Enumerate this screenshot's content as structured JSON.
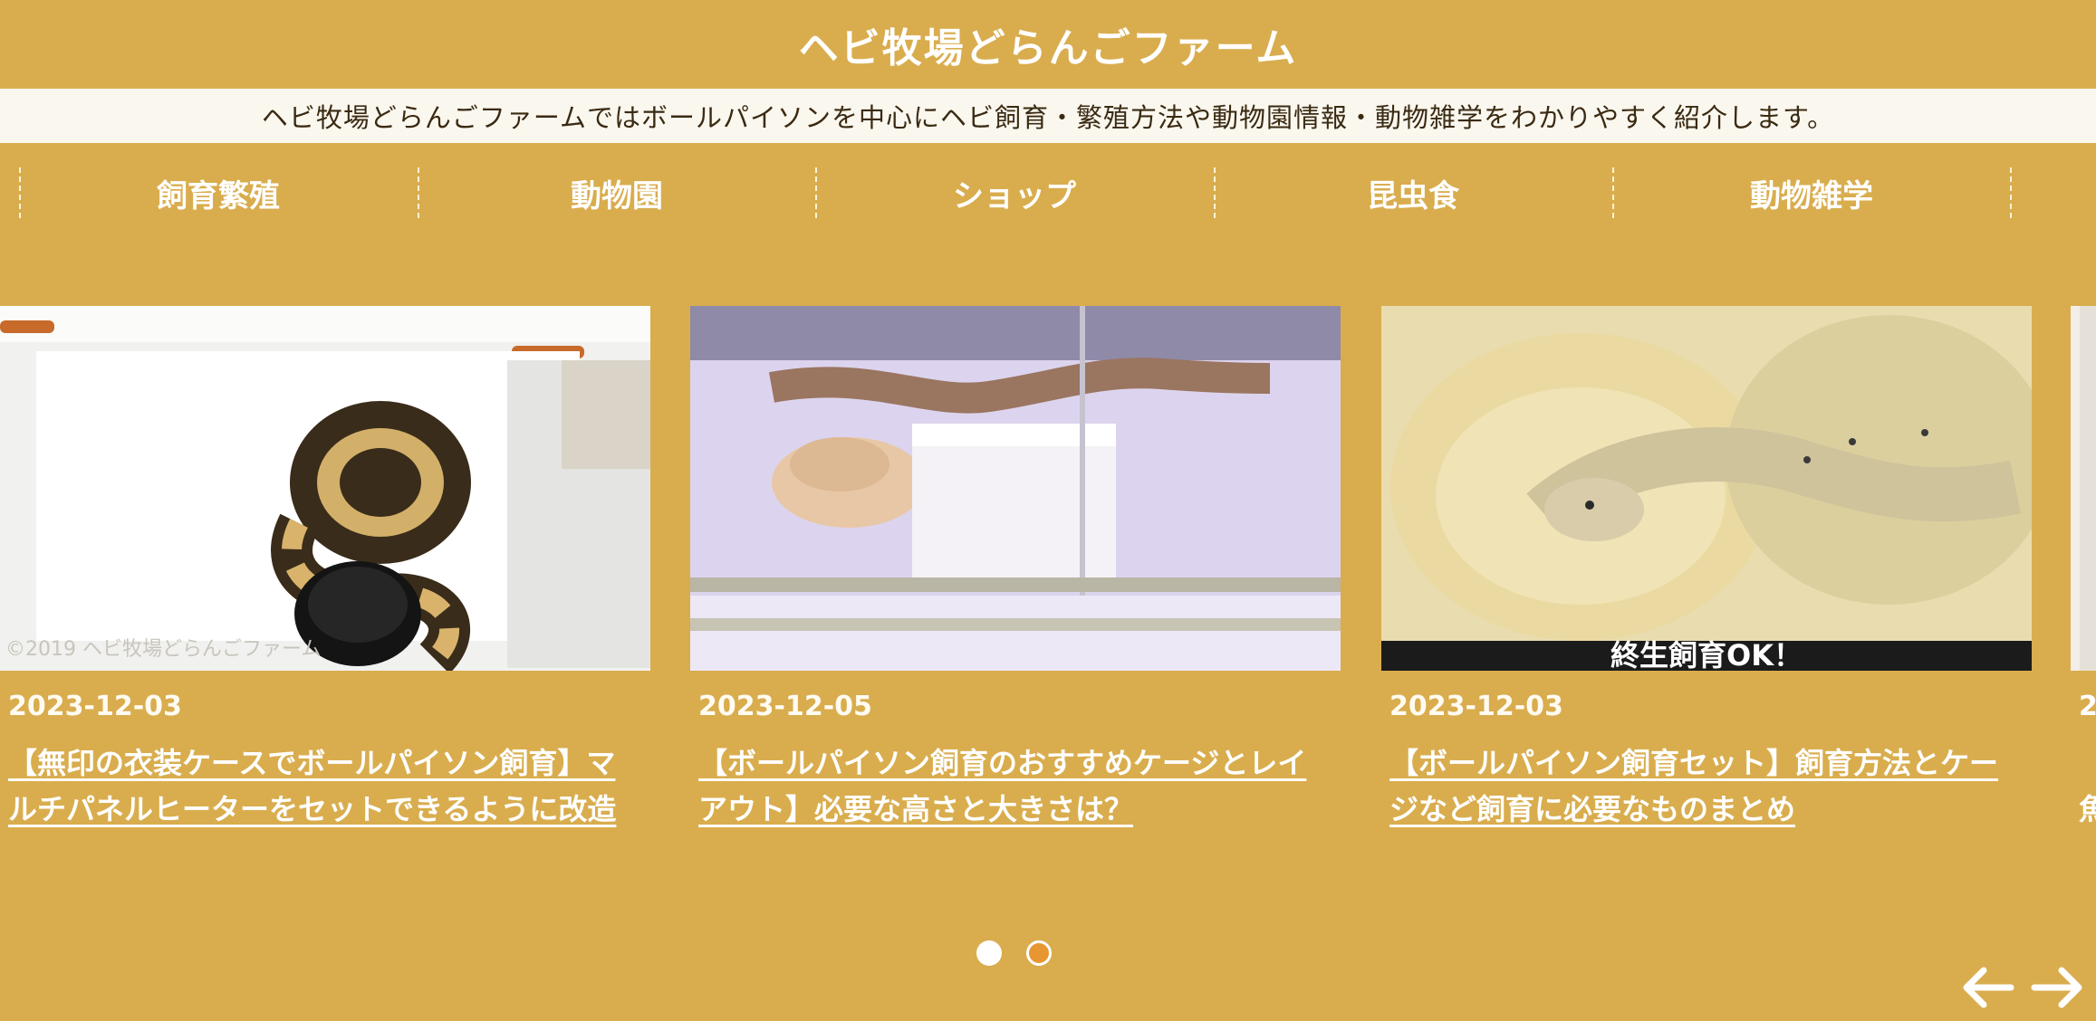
{
  "header": {
    "site_title": "ヘビ牧場どらんごファーム",
    "tagline": "ヘビ牧場どらんごファームではボールパイソンを中心にヘビ飼育・繁殖方法や動物園情報・動物雑学をわかりやすく紹介します。"
  },
  "nav": {
    "items": [
      {
        "label": "飼育繁殖"
      },
      {
        "label": "動物園"
      },
      {
        "label": "ショップ"
      },
      {
        "label": "昆虫食"
      },
      {
        "label": "動物雑学"
      }
    ]
  },
  "slider": {
    "cards": [
      {
        "date": "2023-12-03",
        "title": "【無印の衣装ケースでボールパイソン飼育】マルチパネルヒーターをセットできるように改造",
        "image_watermark": "©2019 ヘビ牧場どらんごファーム"
      },
      {
        "date": "2023-12-05",
        "title": "【ボールパイソン飼育のおすすめケージとレイアウト】必要な高さと大きさは？"
      },
      {
        "date": "2023-12-03",
        "title": "【ボールパイソン飼育セット】飼育方法とケージなど飼育に必要なものまとめ",
        "image_caption": "終生飼育OK！"
      }
    ],
    "peek_card": {
      "date": "2",
      "title_fragment": "【",
      "title_fragment_2": "魚"
    },
    "pagination": {
      "total": 2,
      "active": 1
    },
    "prev_icon": "arrow-left-icon",
    "next_icon": "arrow-right-icon"
  },
  "colors": {
    "background": "#d9ad4e",
    "tagline_bg": "#faf7ef",
    "active_dot": "#e89632"
  }
}
